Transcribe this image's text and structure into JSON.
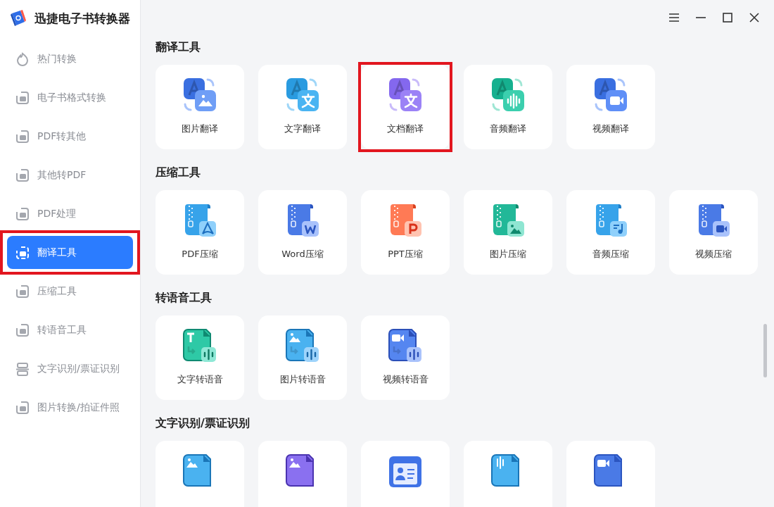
{
  "app": {
    "title": "迅捷电子书转换器"
  },
  "sidebar": {
    "items": [
      {
        "label": "热门转换",
        "selected": false,
        "highlighted": false
      },
      {
        "label": "电子书格式转换",
        "selected": false,
        "highlighted": false
      },
      {
        "label": "PDF转其他",
        "selected": false,
        "highlighted": false
      },
      {
        "label": "其他转PDF",
        "selected": false,
        "highlighted": false
      },
      {
        "label": "PDF处理",
        "selected": false,
        "highlighted": false
      },
      {
        "label": "翻译工具",
        "selected": true,
        "highlighted": true
      },
      {
        "label": "压缩工具",
        "selected": false,
        "highlighted": false
      },
      {
        "label": "转语音工具",
        "selected": false,
        "highlighted": false
      },
      {
        "label": "文字识别/票证识别",
        "selected": false,
        "highlighted": false
      },
      {
        "label": "图片转换/拍证件照",
        "selected": false,
        "highlighted": false
      }
    ]
  },
  "sections": [
    {
      "title": "翻译工具",
      "kind": "translate",
      "tools": [
        {
          "label": "图片翻译",
          "highlighted": false
        },
        {
          "label": "文字翻译",
          "highlighted": false
        },
        {
          "label": "文档翻译",
          "highlighted": true
        },
        {
          "label": "音频翻译",
          "highlighted": false
        },
        {
          "label": "视频翻译",
          "highlighted": false
        }
      ]
    },
    {
      "title": "压缩工具",
      "kind": "zip",
      "tools": [
        {
          "label": "PDF压缩",
          "highlighted": false
        },
        {
          "label": "Word压缩",
          "highlighted": false
        },
        {
          "label": "PPT压缩",
          "highlighted": false
        },
        {
          "label": "图片压缩",
          "highlighted": false
        },
        {
          "label": "音频压缩",
          "highlighted": false
        },
        {
          "label": "视频压缩",
          "highlighted": false
        }
      ]
    },
    {
      "title": "转语音工具",
      "kind": "tts",
      "tools": [
        {
          "label": "文字转语音",
          "highlighted": false
        },
        {
          "label": "图片转语音",
          "highlighted": false
        },
        {
          "label": "视频转语音",
          "highlighted": false
        }
      ]
    },
    {
      "title": "文字识别/票证识别",
      "kind": "ocr",
      "tools": [
        {
          "highlighted": false
        },
        {
          "highlighted": false
        },
        {
          "highlighted": false
        },
        {
          "highlighted": false
        },
        {
          "highlighted": false
        }
      ]
    }
  ]
}
